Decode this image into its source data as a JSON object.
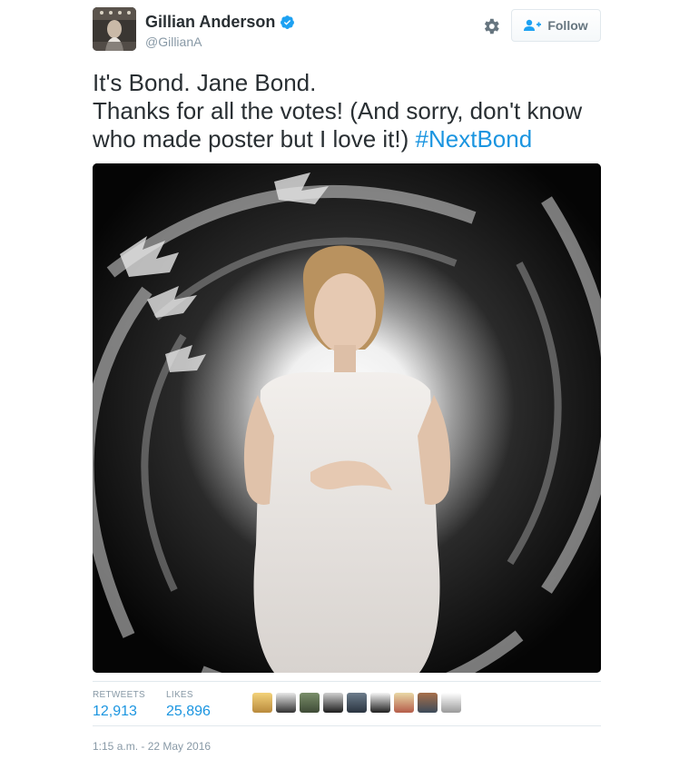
{
  "user": {
    "name": "Gillian Anderson",
    "handle": "@GillianA",
    "verified": true
  },
  "actions": {
    "follow_label": "Follow"
  },
  "tweet": {
    "lines": [
      "It's Bond. Jane Bond.",
      "Thanks for all the votes! (And sorry, don't know",
      "who made poster but I love it!)"
    ],
    "hashtag": "#NextBond"
  },
  "stats": {
    "retweets_label": "RETWEETS",
    "retweets_value": "12,913",
    "likes_label": "LIKES",
    "likes_value": "25,896"
  },
  "likers_count": 9,
  "timestamp": "1:15 a.m. - 22 May 2016",
  "colors": {
    "link": "#1b95e0",
    "muted": "#8899a6",
    "text": "#292f33",
    "border": "#e1e8ed"
  },
  "icons": {
    "verified": "verified-badge-icon",
    "settings": "gear-icon",
    "follow": "add-user-icon"
  }
}
